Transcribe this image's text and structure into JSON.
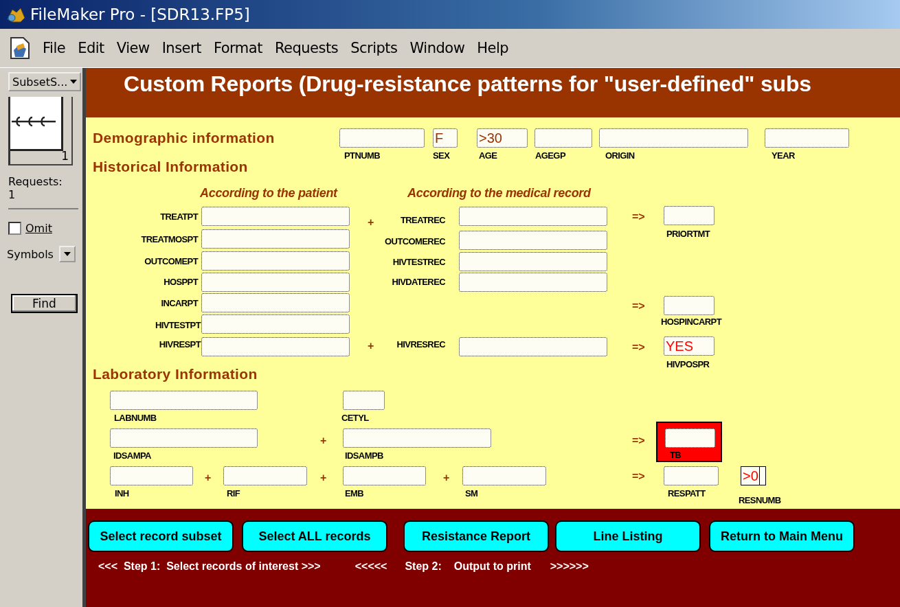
{
  "window": {
    "title": "FileMaker Pro - [SDR13.FP5]"
  },
  "menu": [
    "File",
    "Edit",
    "View",
    "Insert",
    "Format",
    "Requests",
    "Scripts",
    "Window",
    "Help"
  ],
  "status_panel": {
    "layout_menu": "SubsetS...",
    "record_number": "1",
    "requests_label": "Requests:",
    "requests_count": "1",
    "omit": {
      "label": "Omit",
      "checked": false
    },
    "symbols": "Symbols",
    "find_button": "Find"
  },
  "header": {
    "title": "Custom Reports (Drug-resistance patterns for \"user-defined\" subs"
  },
  "layout": [
    {
      "kind": "heading",
      "text": "Demographic information"
    },
    {
      "kind": "field",
      "label": "PTNUMB"
    },
    {
      "kind": "field",
      "label": "SEX",
      "value": "F",
      "color": "#993300"
    },
    {
      "kind": "field",
      "label": "AGE",
      "value": ">30",
      "color": "#993300"
    },
    {
      "kind": "field",
      "label": "AGEGP"
    },
    {
      "kind": "field",
      "label": "ORIGIN"
    },
    {
      "kind": "field",
      "label": "YEAR"
    },
    {
      "kind": "heading",
      "text": "Historical Information"
    },
    {
      "kind": "subheading",
      "text": "According to the patient"
    },
    {
      "kind": "subheading",
      "text": "According to the medical record"
    },
    {
      "kind": "field-left",
      "label": "TREATPT"
    },
    {
      "kind": "operator",
      "text": "+"
    },
    {
      "kind": "field-left",
      "label": "TREATREC"
    },
    {
      "kind": "operator",
      "text": "=>"
    },
    {
      "kind": "field",
      "label": "PRIORTMT"
    },
    {
      "kind": "field-left",
      "label": "TREATMOSPT"
    },
    {
      "kind": "field-left",
      "label": "OUTCOMEREC"
    },
    {
      "kind": "field-left",
      "label": "OUTCOMEPT"
    },
    {
      "kind": "field-left",
      "label": "HIVTESTREC"
    },
    {
      "kind": "field-left",
      "label": "HOSPPT"
    },
    {
      "kind": "field-left",
      "label": "HIVDATEREC"
    },
    {
      "kind": "field-left",
      "label": "INCARPT"
    },
    {
      "kind": "operator",
      "text": "=>"
    },
    {
      "kind": "field",
      "label": "HOSPINCARPT"
    },
    {
      "kind": "field-left",
      "label": "HIVTESTPT"
    },
    {
      "kind": "field-left",
      "label": "HIVRESPT"
    },
    {
      "kind": "operator",
      "text": "+"
    },
    {
      "kind": "field-left",
      "label": "HIVRESREC"
    },
    {
      "kind": "operator",
      "text": "=>"
    },
    {
      "kind": "field",
      "label": "HIVPOSPR",
      "value": "YES",
      "color": "#ff0000"
    },
    {
      "kind": "heading",
      "text": "Laboratory Information"
    },
    {
      "kind": "field",
      "label": "LABNUMB"
    },
    {
      "kind": "field",
      "label": "CETYL"
    },
    {
      "kind": "field",
      "label": "IDSAMPA"
    },
    {
      "kind": "operator",
      "text": "+"
    },
    {
      "kind": "field",
      "label": "IDSAMPB"
    },
    {
      "kind": "operator",
      "text": "=>"
    },
    {
      "kind": "flagged-field",
      "label": "TB"
    },
    {
      "kind": "field",
      "label": "INH"
    },
    {
      "kind": "operator",
      "text": "+"
    },
    {
      "kind": "field",
      "label": "RIF"
    },
    {
      "kind": "operator",
      "text": "+"
    },
    {
      "kind": "field",
      "label": "EMB"
    },
    {
      "kind": "operator",
      "text": "+"
    },
    {
      "kind": "field",
      "label": "SM"
    },
    {
      "kind": "operator",
      "text": "=>"
    },
    {
      "kind": "field",
      "label": "RESPATT"
    },
    {
      "kind": "solid-field",
      "label": "RESNUMB",
      "value": ">0",
      "color": "#ff0000"
    }
  ],
  "buttons": [
    "Select record subset",
    "Select ALL records",
    "Resistance Report",
    "Line Listing",
    "Return to Main Menu"
  ],
  "steps": [
    "<<<  Step 1:  Select records of interest >>>",
    "<<<<<",
    "Step 2:",
    "Output to print",
    ">>>>>>"
  ]
}
